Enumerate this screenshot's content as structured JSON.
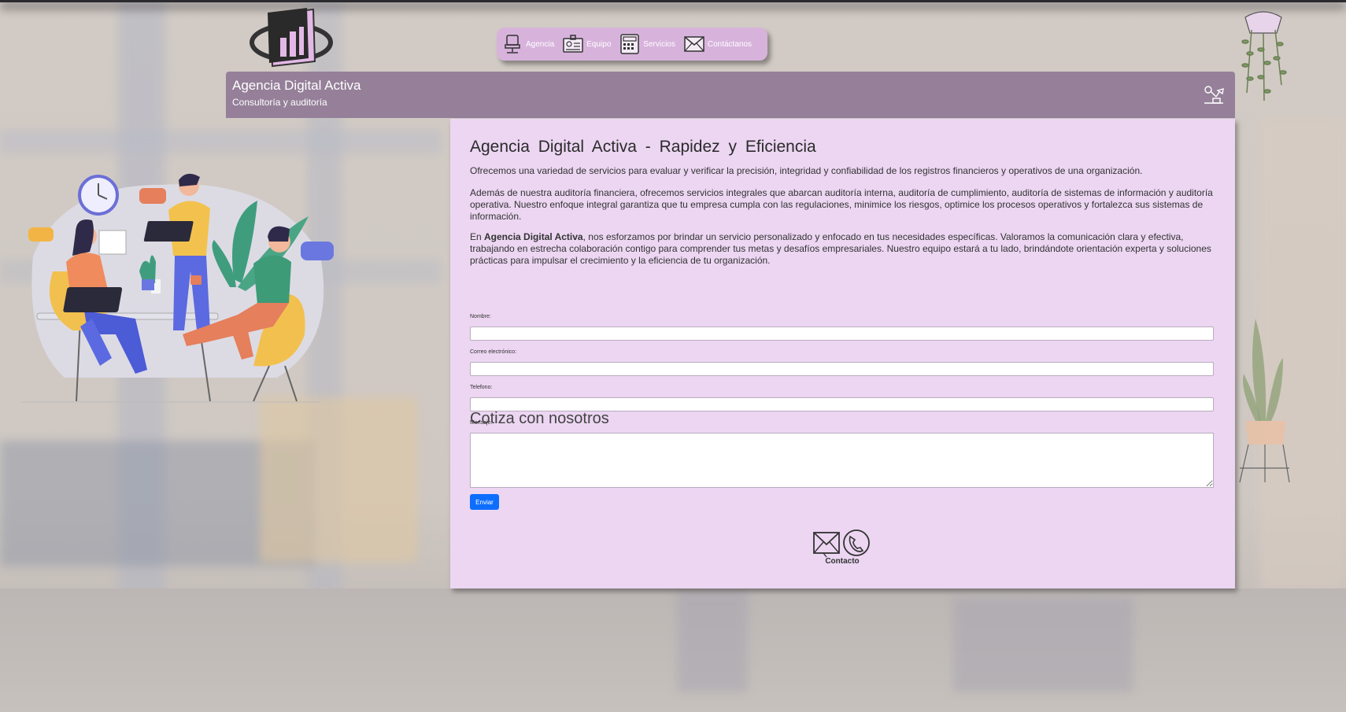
{
  "brand": {
    "title": "Agencia Digital Activa",
    "subtitle": "Consultoría y auditoría"
  },
  "nav": {
    "items": [
      {
        "label": "Agencia",
        "icon": "office-chair-icon"
      },
      {
        "label": "Equipo",
        "icon": "id-card-icon"
      },
      {
        "label": "Servicios",
        "icon": "calculator-icon"
      },
      {
        "label": "Contáctanos",
        "icon": "envelope-icon"
      }
    ]
  },
  "main": {
    "heading": "Agencia Digital Activa - Rapidez y Eficiencia",
    "intro": "Ofrecemos una variedad de servicios para evaluar y verificar la precisión, integridad y confiabilidad de los registros financieros y operativos de una organización.",
    "paragraph2": "Además de nuestra auditoría financiera, ofrecemos servicios integrales que abarcan auditoría interna, auditoría de cumplimiento, auditoría de sistemas de información y auditoría operativa. Nuestro enfoque integral garantiza que tu empresa cumpla con las regulaciones, minimice los riesgos, optimice los procesos operativos y fortalezca sus sistemas de información.",
    "paragraph3_prefix": "En ",
    "paragraph3_bold": "Agencia Digital Activa",
    "paragraph3_rest": ", nos esforzamos por brindar un servicio personalizado y enfocado en tus necesidades específicas. Valoramos la comunicación clara y efectiva, trabajando en estrecha colaboración contigo para comprender tus metas y desafíos empresariales. Nuestro equipo estará a tu lado, brindándote orientación experta y soluciones prácticas para impulsar el crecimiento y la eficiencia de tu organización."
  },
  "form": {
    "heading": "Cotiza con nosotros",
    "name_label": "Nombre:",
    "name_value": "",
    "email_label": "Correo electrónico:",
    "email_value": "",
    "phone_label": "Telefono:",
    "phone_value": "",
    "message_label": "Mensaje:",
    "message_value": "",
    "submit_label": "Enviar"
  },
  "contact": {
    "label": "Contacto",
    "icons": [
      "envelope-icon",
      "phone-icon"
    ]
  },
  "colors": {
    "banner": "#957f99",
    "nav": "#d7b3dc",
    "card": "#ecd6f2",
    "button": "#0d6efd"
  }
}
